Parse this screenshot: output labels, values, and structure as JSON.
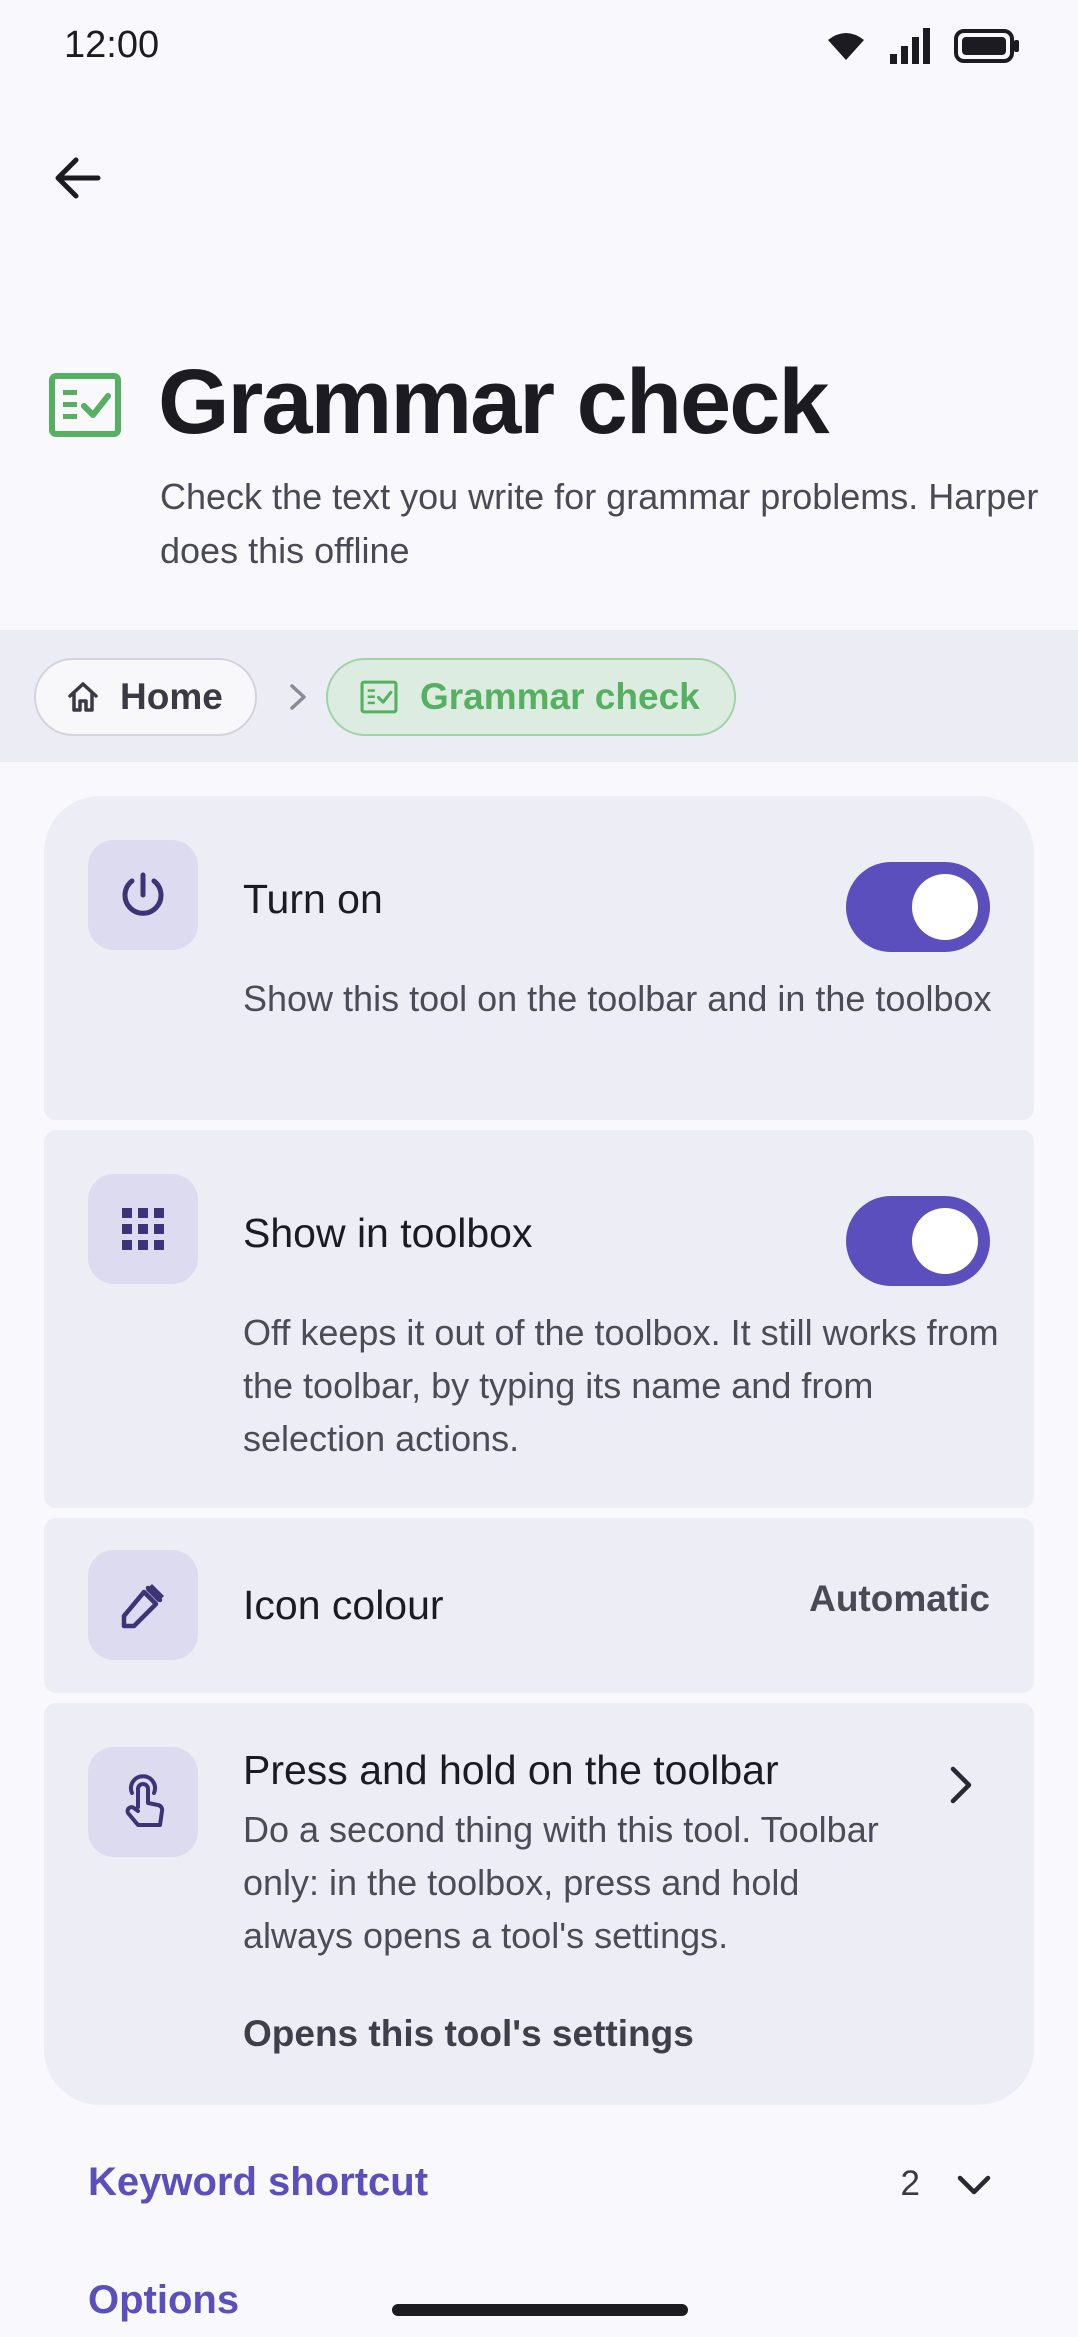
{
  "status_bar": {
    "time": "12:00",
    "icons": [
      "wifi-icon",
      "signal-icon",
      "battery-icon"
    ]
  },
  "header": {
    "back_icon": "arrow-left-icon",
    "title": "Grammar check",
    "subtitle": "Check the text you write for grammar problems. Harper does this offline",
    "title_icon": "grammar-check-icon"
  },
  "breadcrumb": {
    "home_label": "Home",
    "current_label": "Grammar check"
  },
  "settings": {
    "turn_on": {
      "title": "Turn on",
      "description": "Show this tool on the toolbar and in the toolbox",
      "enabled": true
    },
    "show_in_toolbox": {
      "title": "Show in toolbox",
      "description": "Off keeps it out of the toolbox. It still works from the toolbar, by typing its name and from selection actions.",
      "enabled": true
    },
    "icon_colour": {
      "title": "Icon colour",
      "value": "Automatic"
    },
    "press_and_hold": {
      "title": "Press and hold on the toolbar",
      "description": "Do a second thing with this tool. Toolbar only: in the toolbox, press and hold always opens a tool's settings.",
      "value": "Opens this tool's settings"
    }
  },
  "sections": {
    "keyword_shortcut": {
      "label": "Keyword shortcut",
      "count": "2"
    },
    "options": {
      "label": "Options"
    }
  },
  "colors": {
    "accent": "#5a4fbd",
    "success": "#56b062",
    "card": "#ededf6",
    "background": "#f8f8fd"
  }
}
